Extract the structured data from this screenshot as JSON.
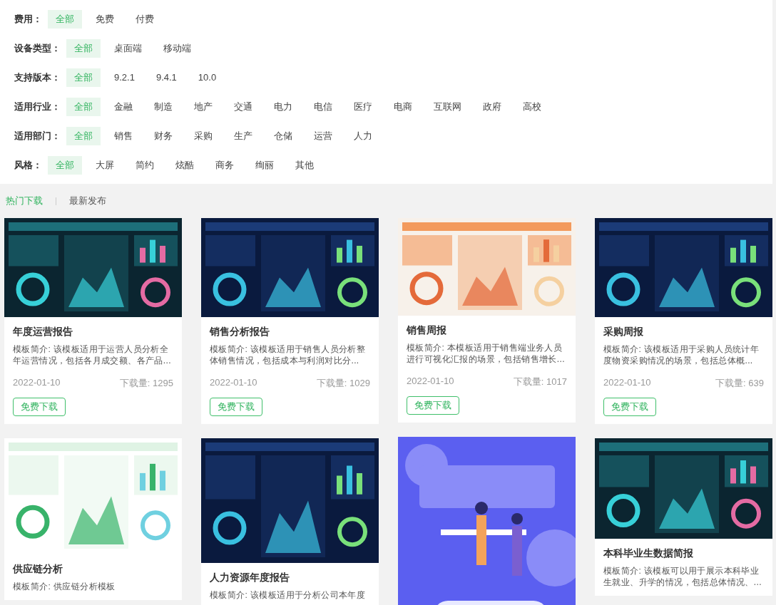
{
  "filters": [
    {
      "label": "费用：",
      "options": [
        {
          "text": "全部",
          "selected": true
        },
        {
          "text": "免费",
          "selected": false
        },
        {
          "text": "付费",
          "selected": false
        }
      ]
    },
    {
      "label": "设备类型：",
      "options": [
        {
          "text": "全部",
          "selected": true
        },
        {
          "text": "桌面端",
          "selected": false
        },
        {
          "text": "移动端",
          "selected": false
        }
      ]
    },
    {
      "label": "支持版本：",
      "options": [
        {
          "text": "全部",
          "selected": true
        },
        {
          "text": "9.2.1",
          "selected": false
        },
        {
          "text": "9.4.1",
          "selected": false
        },
        {
          "text": "10.0",
          "selected": false
        }
      ]
    },
    {
      "label": "适用行业：",
      "options": [
        {
          "text": "全部",
          "selected": true
        },
        {
          "text": "金融",
          "selected": false
        },
        {
          "text": "制造",
          "selected": false
        },
        {
          "text": "地产",
          "selected": false
        },
        {
          "text": "交通",
          "selected": false
        },
        {
          "text": "电力",
          "selected": false
        },
        {
          "text": "电信",
          "selected": false
        },
        {
          "text": "医疗",
          "selected": false
        },
        {
          "text": "电商",
          "selected": false
        },
        {
          "text": "互联网",
          "selected": false
        },
        {
          "text": "政府",
          "selected": false
        },
        {
          "text": "高校",
          "selected": false
        }
      ]
    },
    {
      "label": "适用部门：",
      "options": [
        {
          "text": "全部",
          "selected": true
        },
        {
          "text": "销售",
          "selected": false
        },
        {
          "text": "财务",
          "selected": false
        },
        {
          "text": "采购",
          "selected": false
        },
        {
          "text": "生产",
          "selected": false
        },
        {
          "text": "仓储",
          "selected": false
        },
        {
          "text": "运营",
          "selected": false
        },
        {
          "text": "人力",
          "selected": false
        }
      ]
    },
    {
      "label": "风格：",
      "options": [
        {
          "text": "全部",
          "selected": true
        },
        {
          "text": "大屏",
          "selected": false
        },
        {
          "text": "简约",
          "selected": false
        },
        {
          "text": "炫酷",
          "selected": false
        },
        {
          "text": "商务",
          "selected": false
        },
        {
          "text": "绚丽",
          "selected": false
        },
        {
          "text": "其他",
          "selected": false
        }
      ]
    }
  ],
  "tabs": [
    {
      "label": "热门下载",
      "selected": true
    },
    {
      "label": "最新发布",
      "selected": false
    }
  ],
  "cards": [
    {
      "title": "年度运营报告",
      "description": "模板简介: 该模板适用于运营人员分析全年运营情况，包括各月成交额、各产品...",
      "date": "2022-01-10",
      "downloads": "下载量: 1295",
      "button": "免费下载"
    },
    {
      "title": "销售分析报告",
      "description": "模板简介: 该模板适用于销售人员分析整体销售情况，包括成本与利润对比分...",
      "date": "2022-01-10",
      "downloads": "下载量: 1029",
      "button": "免费下载"
    },
    {
      "title": "销售周报",
      "description": "模板简介: 本模板适用于销售端业务人员进行可视化汇报的场景，包括销售增长...",
      "date": "2022-01-10",
      "downloads": "下载量: 1017",
      "button": "免费下载"
    },
    {
      "title": "采购周报",
      "description": "模板简介: 该模板适用于采购人员统计年度物资采购情况的场景，包括总体概...",
      "date": "2022-01-10",
      "downloads": "下载量: 639",
      "button": "免费下载"
    },
    {
      "title": "供应链分析",
      "description": "模板简介: 供应链分析模板"
    },
    {
      "title": "人力资源年度报告",
      "description": "模板简介: 该模板适用于分析公司本年度"
    },
    {
      "kind": "picture"
    },
    {
      "title": "本科毕业生数据简报",
      "description": "模板简介: 该模板可以用于展示本科毕业生就业、升学的情况，包括总体情况、..."
    }
  ]
}
